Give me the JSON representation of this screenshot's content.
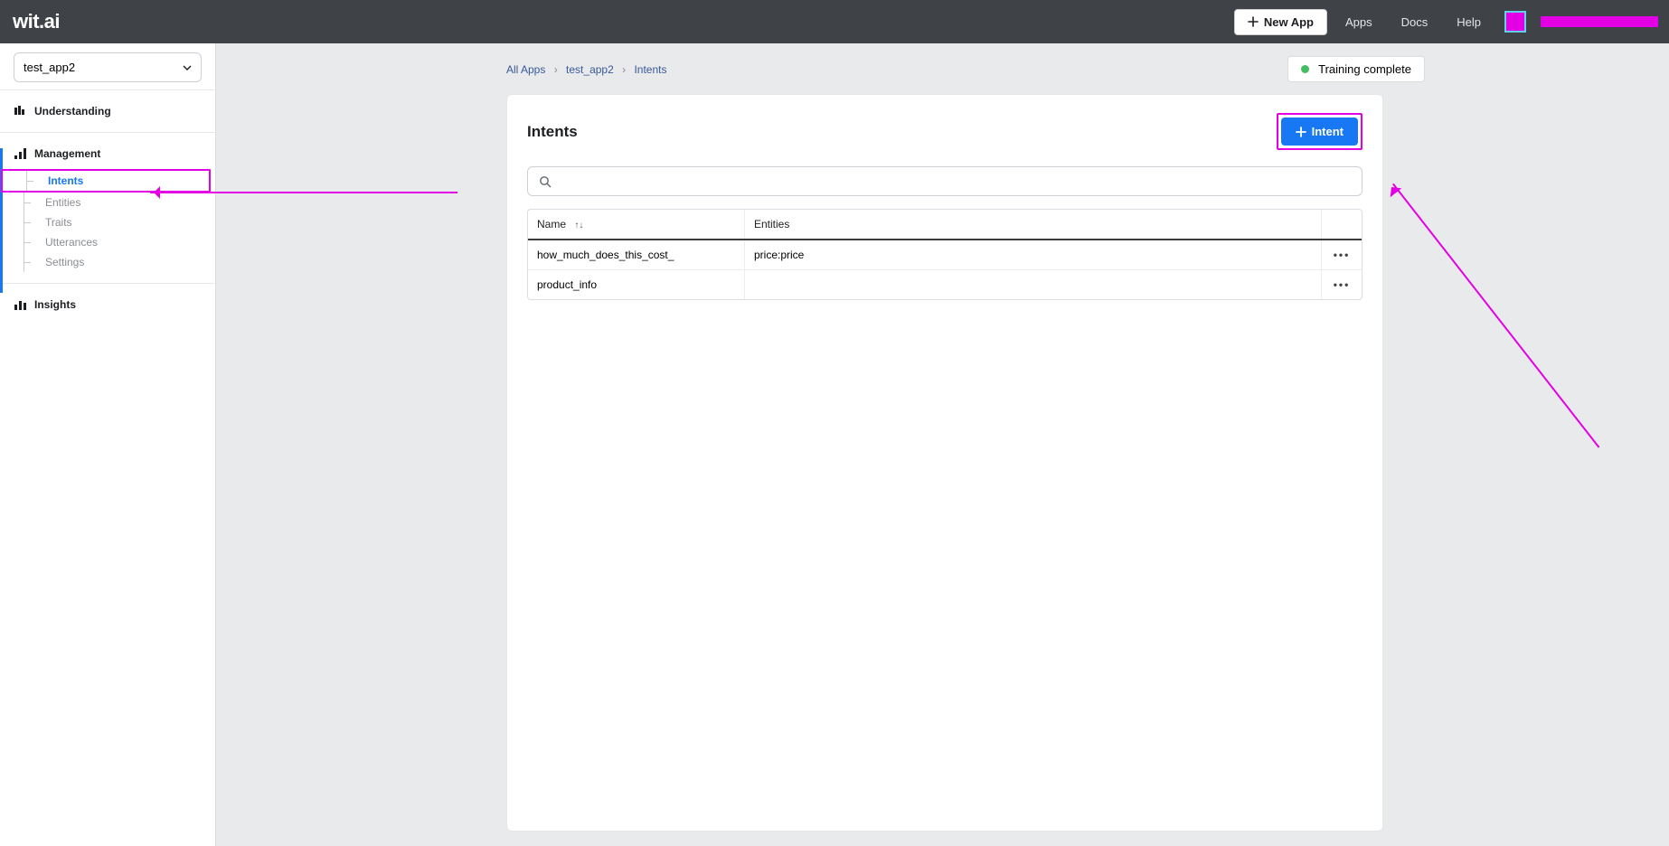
{
  "brand": "wit.ai",
  "topbar": {
    "new_app": "New App",
    "links": [
      "Apps",
      "Docs",
      "Help"
    ]
  },
  "sidebar": {
    "app_selected": "test_app2",
    "sections": {
      "understanding": "Understanding",
      "management": "Management",
      "insights": "Insights"
    },
    "management_items": [
      {
        "label": "Intents",
        "active": true
      },
      {
        "label": "Entities",
        "active": false
      },
      {
        "label": "Traits",
        "active": false
      },
      {
        "label": "Utterances",
        "active": false
      },
      {
        "label": "Settings",
        "active": false
      }
    ]
  },
  "breadcrumb": {
    "items": [
      "All Apps",
      "test_app2",
      "Intents"
    ]
  },
  "status": {
    "text": "Training complete",
    "color": "#45bd62"
  },
  "card": {
    "title": "Intents",
    "add_button": "Intent",
    "search_placeholder": "",
    "columns": {
      "name": "Name",
      "entities": "Entities"
    },
    "rows": [
      {
        "name": "how_much_does_this_cost_",
        "entities": "price:price"
      },
      {
        "name": "product_info",
        "entities": ""
      }
    ]
  }
}
